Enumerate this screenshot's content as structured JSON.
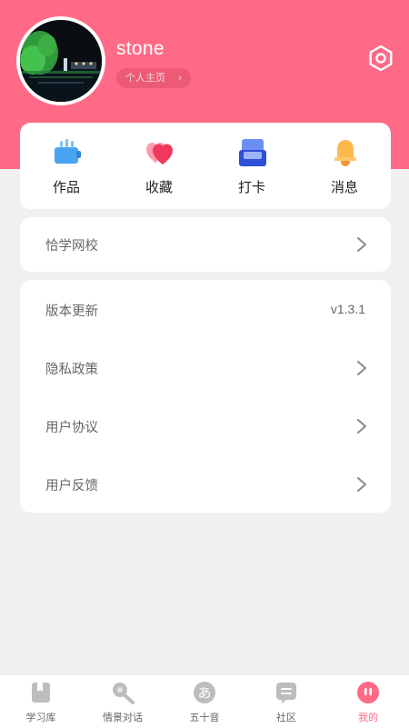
{
  "profile": {
    "username": "stone",
    "home_link": "个人主页"
  },
  "quick_actions": [
    {
      "label": "作品",
      "icon": "works-icon"
    },
    {
      "label": "收藏",
      "icon": "heart-icon"
    },
    {
      "label": "打卡",
      "icon": "checkin-icon"
    },
    {
      "label": "消息",
      "icon": "bell-icon"
    }
  ],
  "menu": {
    "school": "恰学网校",
    "version_label": "版本更新",
    "version_value": "v1.3.1",
    "privacy": "隐私政策",
    "agreement": "用户协议",
    "feedback": "用户反馈"
  },
  "tabs": [
    {
      "label": "学习库",
      "icon": "book-icon"
    },
    {
      "label": "情景对话",
      "icon": "microphone-icon"
    },
    {
      "label": "五十音",
      "icon": "kana-icon"
    },
    {
      "label": "社区",
      "icon": "chat-icon"
    },
    {
      "label": "我的",
      "icon": "profile-icon"
    }
  ],
  "colors": {
    "accent": "#ff6b86",
    "background": "#f0f0f0"
  }
}
